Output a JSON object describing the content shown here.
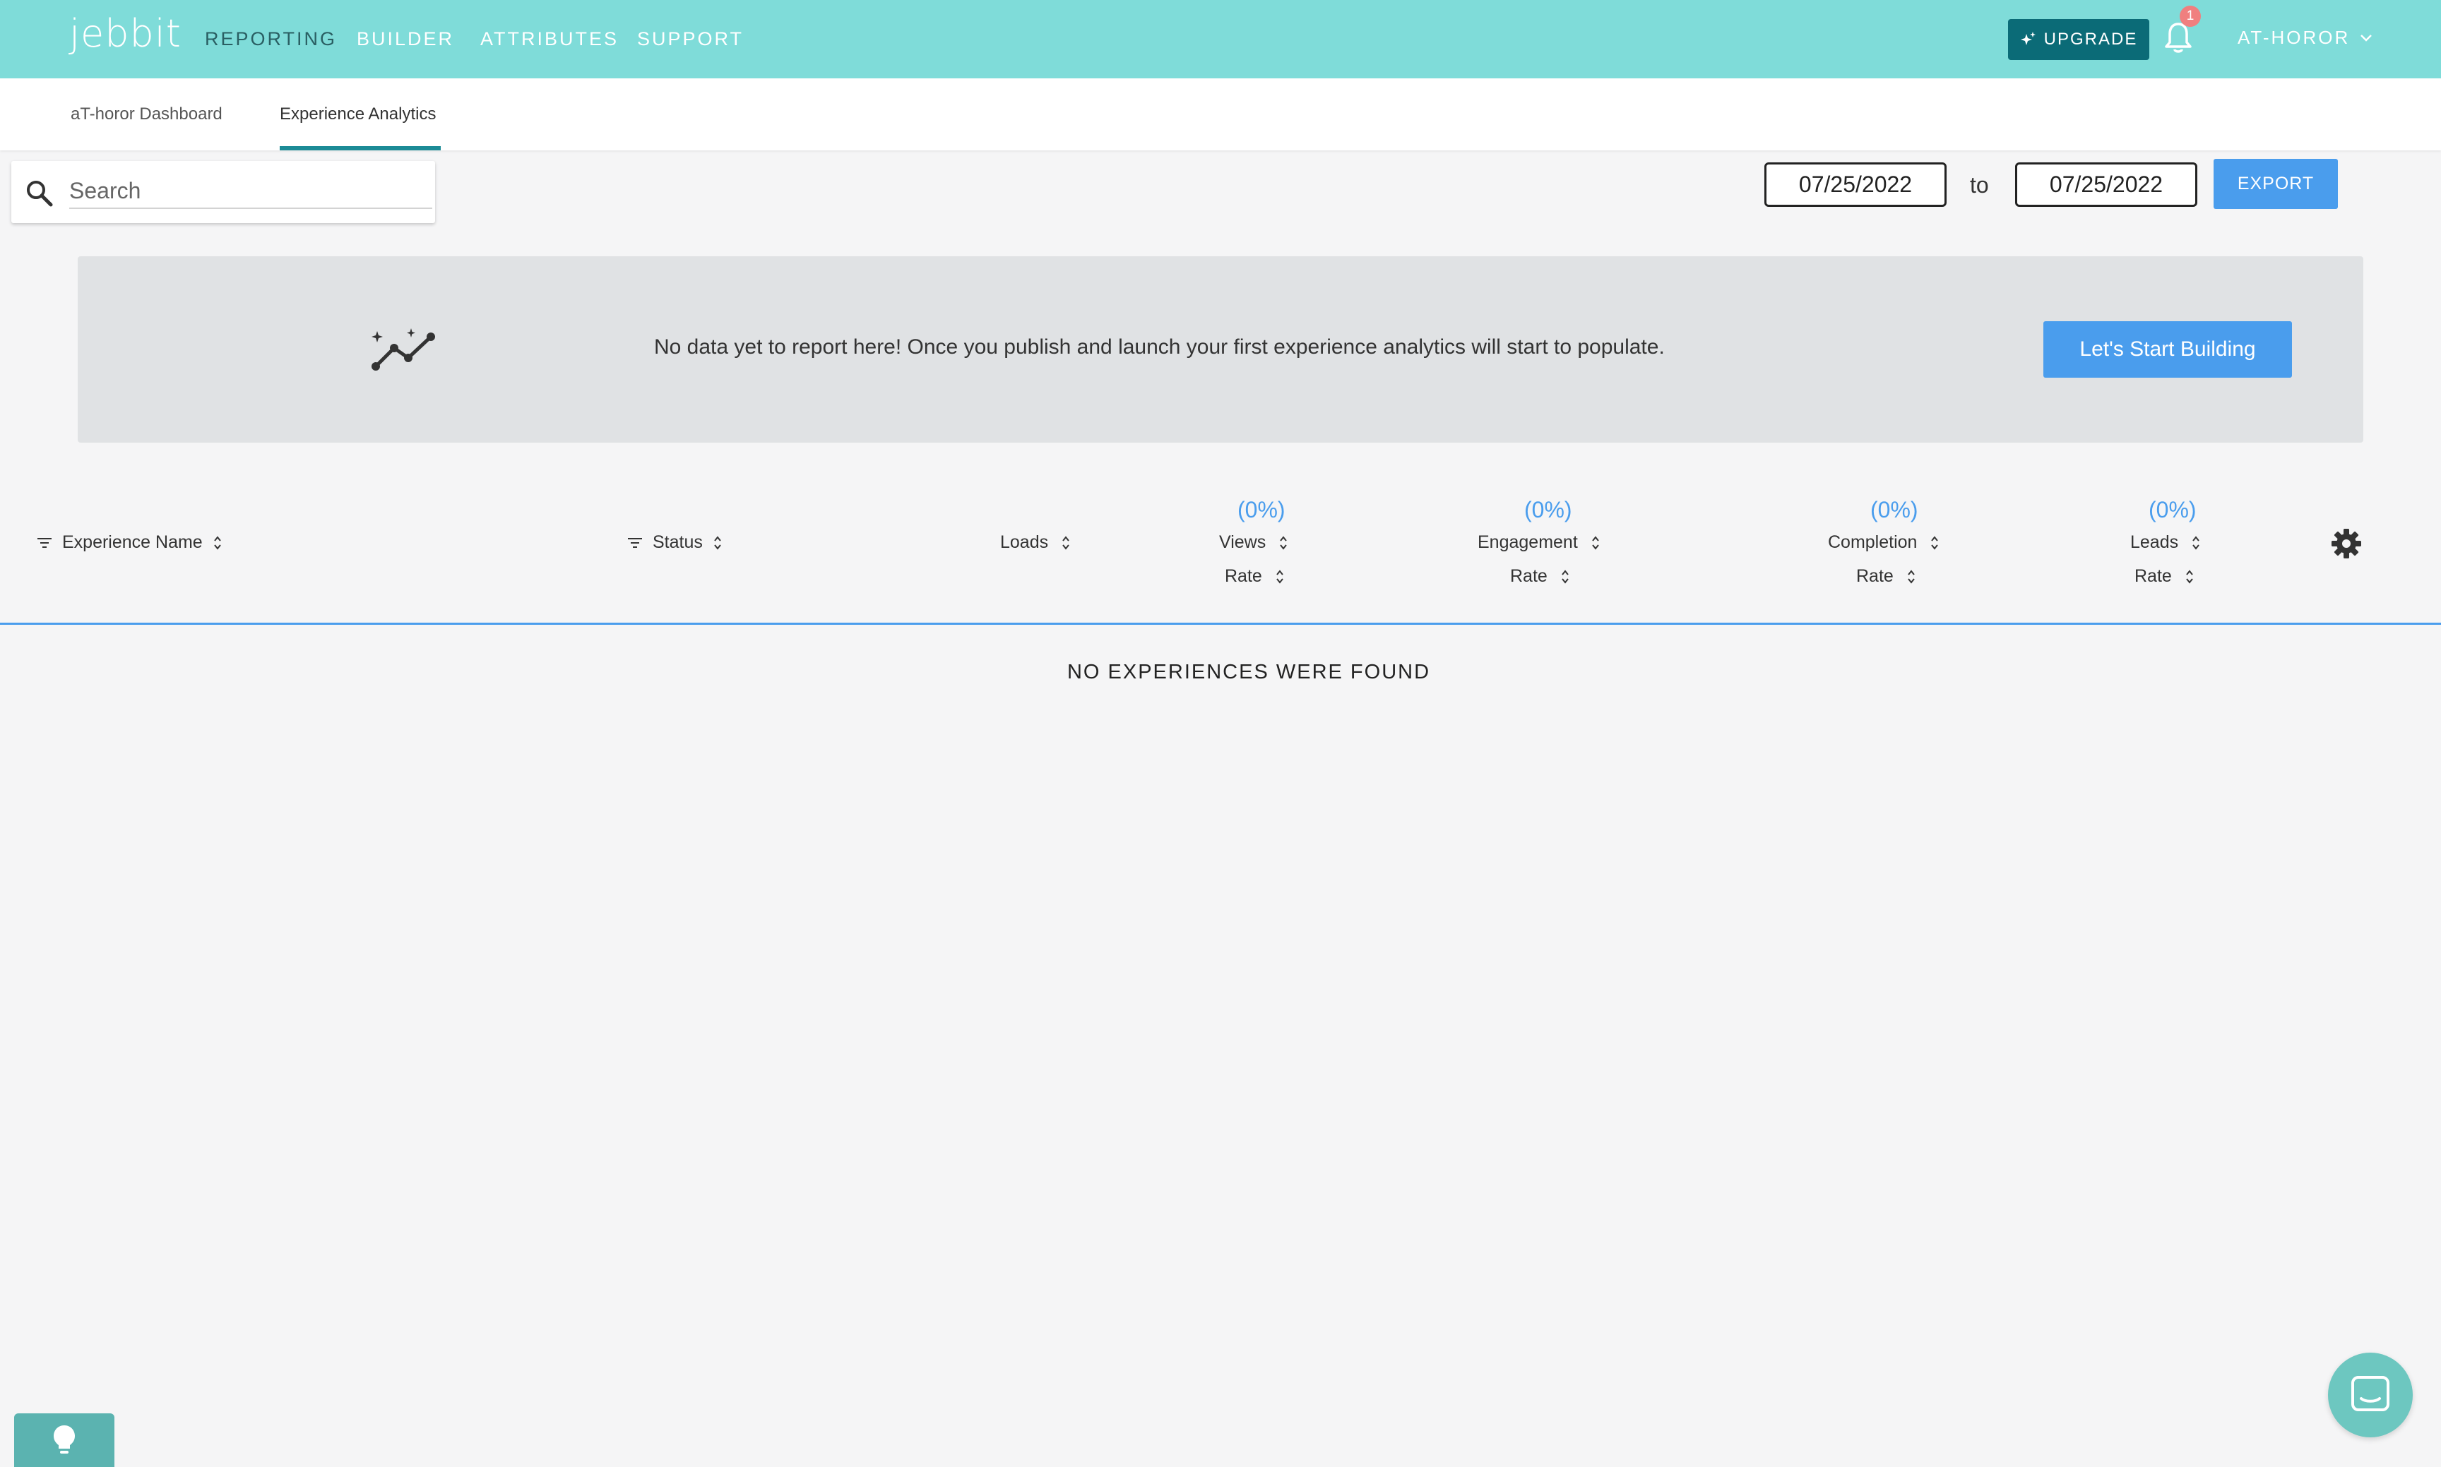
{
  "topnav": {
    "logo": "jebbit",
    "items": [
      {
        "label": "REPORTING",
        "active": true
      },
      {
        "label": "BUILDER",
        "active": false
      },
      {
        "label": "ATTRIBUTES",
        "active": false
      },
      {
        "label": "SUPPORT",
        "active": false
      }
    ],
    "upgrade_label": "UPGRADE",
    "notification_count": "1",
    "account_label": "AT-HOROR"
  },
  "subtabs": [
    {
      "label": "aT-horor Dashboard",
      "active": false
    },
    {
      "label": "Experience Analytics",
      "active": true
    }
  ],
  "search": {
    "placeholder": "Search",
    "value": ""
  },
  "date_range": {
    "from": "07/25/2022",
    "separator": "to",
    "to": "07/25/2022"
  },
  "export_label": "EXPORT",
  "banner": {
    "icon": "analytics-sparkle-icon",
    "text": "No data yet to report here! Once you publish and launch your first experience analytics will start to populate.",
    "button_label": "Let's Start Building"
  },
  "table": {
    "columns": [
      {
        "label": "Experience Name",
        "filter": true
      },
      {
        "label": "Status",
        "filter": true
      },
      {
        "label": "Loads"
      },
      {
        "label": "Views",
        "pct": "(0%)",
        "sub": "Rate"
      },
      {
        "label": "Engagement",
        "pct": "(0%)",
        "sub": "Rate"
      },
      {
        "label": "Completion",
        "pct": "(0%)",
        "sub": "Rate"
      },
      {
        "label": "Leads",
        "pct": "(0%)",
        "sub": "Rate"
      }
    ],
    "empty_message": "NO EXPERIENCES WERE FOUND"
  },
  "colors": {
    "topbar": "#7fdcd9",
    "accent": "#4a9ded",
    "upgrade": "#0b6b77",
    "tab_underline": "#1c8b96"
  }
}
